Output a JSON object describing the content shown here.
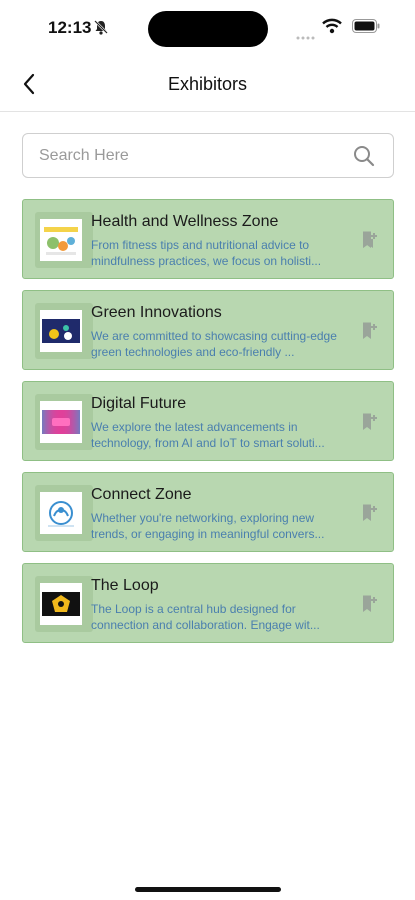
{
  "status": {
    "time": "12:13"
  },
  "nav": {
    "title": "Exhibitors"
  },
  "search": {
    "placeholder": "Search Here"
  },
  "exhibitors": [
    {
      "name": "Health and Wellness Zone",
      "description": "From fitness tips and nutritional advice to mindfulness practices, we focus on holisti..."
    },
    {
      "name": "Green Innovations",
      "description": "We are committed to showcasing cutting-edge green technologies and eco-friendly ..."
    },
    {
      "name": "Digital Future",
      "description": "We explore the latest advancements in technology, from AI and IoT to smart soluti..."
    },
    {
      "name": "Connect Zone",
      "description": "Whether you're networking, exploring new trends, or engaging in meaningful convers..."
    },
    {
      "name": "The Loop",
      "description": "The Loop is a central hub designed for connection and collaboration. Engage wit..."
    }
  ],
  "colors": {
    "card_bg": "#b8d7b0",
    "card_border": "#8fbf85",
    "description_text": "#4a7fae"
  }
}
